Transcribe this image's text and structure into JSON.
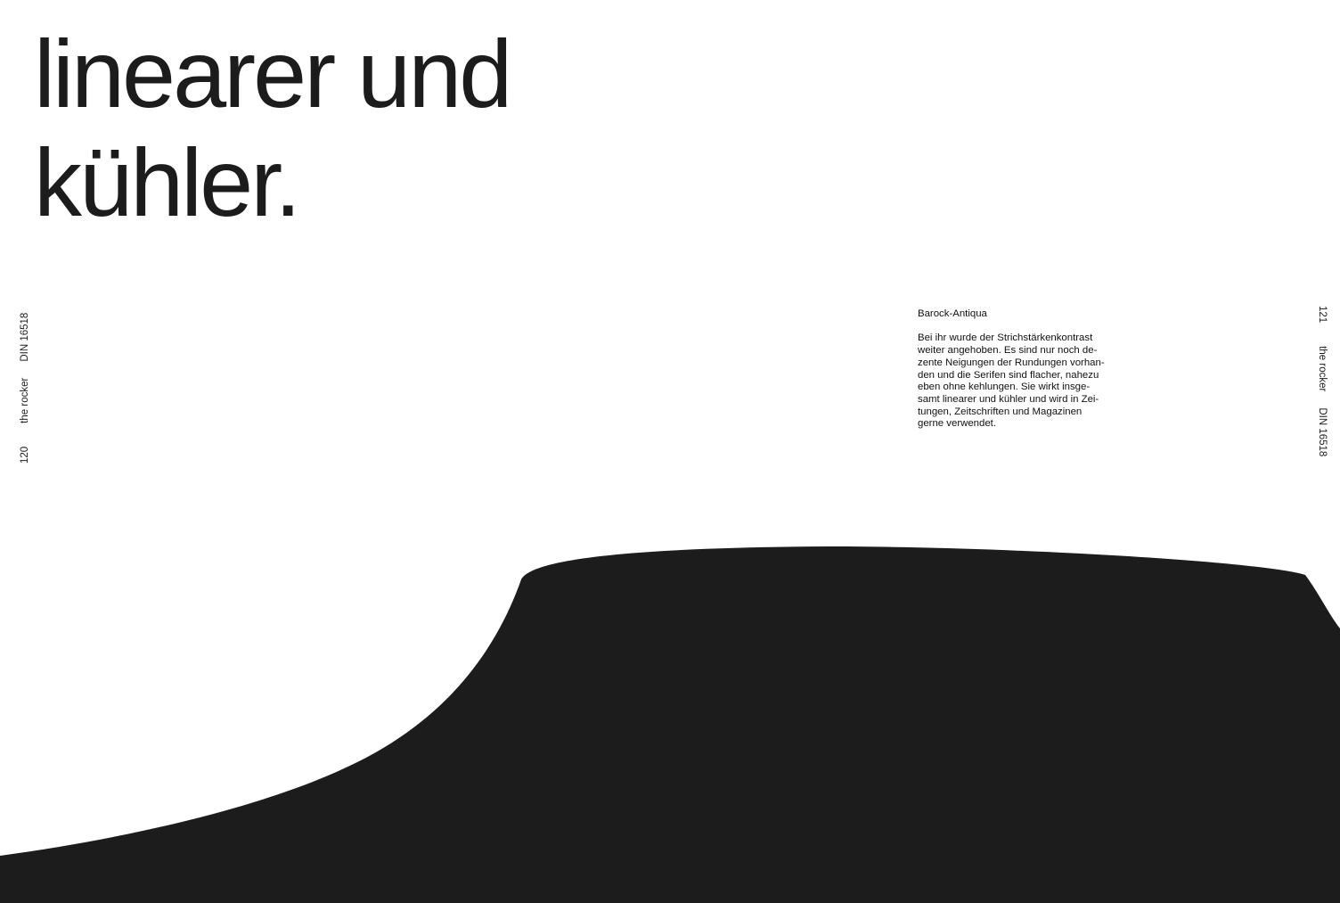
{
  "headline": {
    "line1": "linearer und",
    "line2": "kühler."
  },
  "left_margin": {
    "page_number": "120",
    "title": "the rocker",
    "standard": "DIN 16518"
  },
  "right_margin": {
    "page_number": "121",
    "title": "the rocker",
    "standard": "DIN 16518"
  },
  "text": {
    "heading": "Barock-Antiqua",
    "lines": [
      "Bei ihr wurde der Strichstärkenkontrast",
      "weiter angehoben. Es sind nur noch de-",
      "zente Neigungen der Rundungen vorhan-",
      "den und die Serifen  sind flacher, nahezu",
      "eben ohne kehlungen. Sie wirkt insge-",
      "samt linearer und kühler und wird in Zei-",
      "tungen, Zeitschriften und Magazinen",
      "gerne verwendet."
    ]
  },
  "colors": {
    "ink": "#1c1c1c",
    "background": "#ffffff"
  }
}
